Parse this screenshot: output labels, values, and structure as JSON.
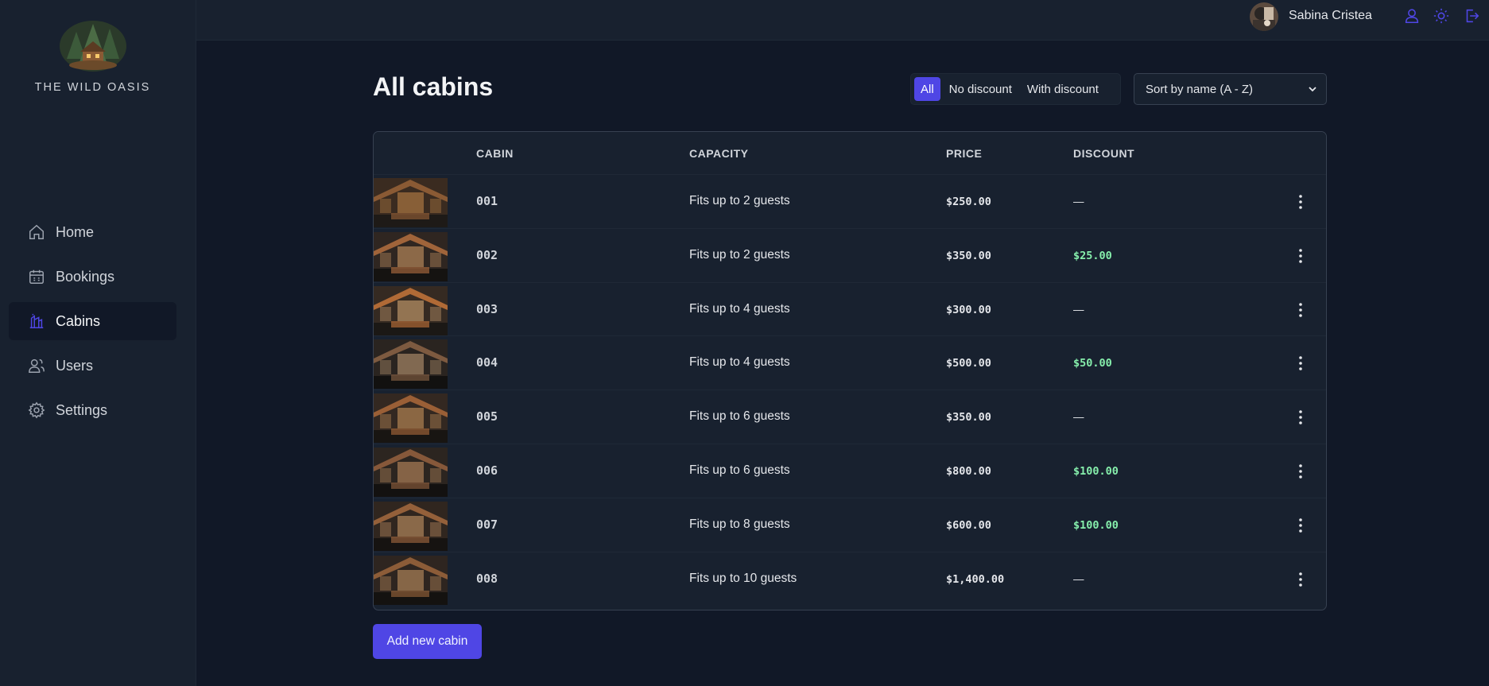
{
  "brand": {
    "name": "THE WILD OASIS"
  },
  "nav": {
    "items": [
      {
        "label": "Home",
        "icon": "home-icon",
        "active": false
      },
      {
        "label": "Bookings",
        "icon": "calendar-icon",
        "active": false
      },
      {
        "label": "Cabins",
        "icon": "building-icon",
        "active": true
      },
      {
        "label": "Users",
        "icon": "users-icon",
        "active": false
      },
      {
        "label": "Settings",
        "icon": "gear-icon",
        "active": false
      }
    ]
  },
  "header": {
    "user_name": "Sabina Cristea",
    "icons": [
      "user-icon",
      "sun-icon",
      "logout-icon"
    ]
  },
  "page": {
    "title": "All cabins"
  },
  "filter": {
    "options": [
      "All",
      "No discount",
      "With discount"
    ],
    "selected": "All"
  },
  "sort": {
    "value": "Sort by name (A - Z)"
  },
  "table": {
    "headers": {
      "cabin": "CABIN",
      "capacity": "CAPACITY",
      "price": "PRICE",
      "discount": "DISCOUNT"
    },
    "rows": [
      {
        "cabin": "001",
        "capacity": "Fits up to 2 guests",
        "price": "$250.00",
        "discount": "—"
      },
      {
        "cabin": "002",
        "capacity": "Fits up to 2 guests",
        "price": "$350.00",
        "discount": "$25.00"
      },
      {
        "cabin": "003",
        "capacity": "Fits up to 4 guests",
        "price": "$300.00",
        "discount": "—"
      },
      {
        "cabin": "004",
        "capacity": "Fits up to 4 guests",
        "price": "$500.00",
        "discount": "$50.00"
      },
      {
        "cabin": "005",
        "capacity": "Fits up to 6 guests",
        "price": "$350.00",
        "discount": "—"
      },
      {
        "cabin": "006",
        "capacity": "Fits up to 6 guests",
        "price": "$800.00",
        "discount": "$100.00"
      },
      {
        "cabin": "007",
        "capacity": "Fits up to 8 guests",
        "price": "$600.00",
        "discount": "$100.00"
      },
      {
        "cabin": "008",
        "capacity": "Fits up to 10 guests",
        "price": "$1,400.00",
        "discount": "—"
      }
    ]
  },
  "actions": {
    "add_label": "Add new cabin"
  },
  "colors": {
    "accent": "#4f46e5",
    "discount": "#86efac",
    "background": "#111827",
    "panel": "#18212f"
  }
}
